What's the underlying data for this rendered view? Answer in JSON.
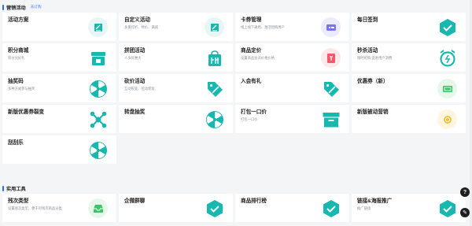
{
  "sections": {
    "marketing": {
      "title": "营销活动",
      "sub": "去订购"
    },
    "tools": {
      "title": "实用工具"
    }
  },
  "cards": {
    "c1": {
      "title": "活动方案",
      "desc": "",
      "icon": "edit-note-icon"
    },
    "c2": {
      "title": "自定义活动",
      "desc": "多重打折、特价、满减",
      "icon": "edit-note-icon"
    },
    "c3": {
      "title": "卡券管理",
      "desc": "线上线下通用、激活团购用户",
      "icon": "ticket-icon"
    },
    "c4": {
      "title": "每日签到",
      "desc": "",
      "icon": "check-badge-icon"
    },
    "c5": {
      "title": "积分商城",
      "desc": "积分兑好礼",
      "icon": "store-icon"
    },
    "c6": {
      "title": "拼团活动",
      "desc": "人多优惠大",
      "icon": "group-bag-icon"
    },
    "c7": {
      "title": "商品定价",
      "desc": "设置商品会员价格价格",
      "icon": "price-tag-icon"
    },
    "c8": {
      "title": "秒杀活动",
      "desc": "限时抢购,促进用户消费",
      "icon": "alarm-clock-icon"
    },
    "c9": {
      "title": "抽奖码",
      "desc": "多种方式参与抽奖",
      "icon": "wheel-icon"
    },
    "c10": {
      "title": "砍价活动",
      "desc": "互动裂变、拉动新客",
      "icon": "tag-percent-icon"
    },
    "c11": {
      "title": "入会有礼",
      "desc": "",
      "icon": "tag-percent-icon"
    },
    "c12": {
      "title": "优惠券（新）",
      "desc": "",
      "icon": "coupon-icon"
    },
    "c13": {
      "title": "新版优惠券裂变",
      "desc": "",
      "icon": "share-network-icon"
    },
    "c14": {
      "title": "转盘抽奖",
      "desc": "",
      "icon": "wheel-icon"
    },
    "c15": {
      "title": "打包一口价",
      "desc": "打包一口价",
      "icon": "package-box-icon"
    },
    "c16": {
      "title": "新版被动营销",
      "desc": "",
      "icon": "coin-icon"
    },
    "c17": {
      "title": "刮刮乐",
      "desc": "",
      "icon": "wheel-icon"
    },
    "t1": {
      "title": "残次类型",
      "desc": "设置残次类型，便于对残次商品分类",
      "icon": "inbox-icon"
    },
    "t2": {
      "title": "企微群聊",
      "desc": "",
      "icon": "check-badge-icon"
    },
    "t3": {
      "title": "商品排行榜",
      "desc": "",
      "icon": "check-badge-icon"
    },
    "t4": {
      "title": "链接&海报推广",
      "desc": "推广链接",
      "icon": "check-badge-icon"
    }
  },
  "fab": {
    "help": "?",
    "edit": "✎"
  },
  "colors": {
    "teal": "#17b8b0",
    "accent_blue": "#2a6df4"
  }
}
